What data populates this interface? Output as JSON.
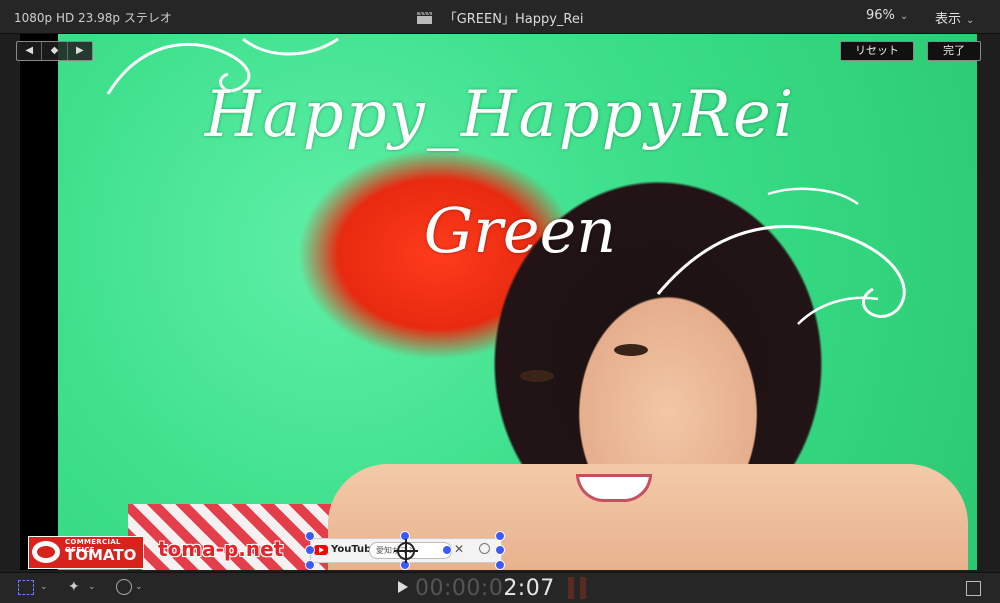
{
  "header": {
    "format_info": "1080p HD 23.98p ステレオ",
    "project_title": "「GREEN」Happy_Rei",
    "zoom_level": "96%",
    "view_menu": "表示",
    "chevron": "⌄"
  },
  "overlay_controls": {
    "prev_keyframe": "◀",
    "add_keyframe": "◆",
    "next_keyframe": "▶",
    "reset_label": "リセット",
    "done_label": "完了"
  },
  "video": {
    "title_line1": "Happy_HappyRei",
    "title_line2": "Green",
    "logo_small": "COMMERCIAL OFFICE",
    "logo_main": "TOMATO",
    "site_url": "toma-p.net",
    "youtube_word": "YouTube",
    "youtube_search_text": "愛知がマン",
    "youtube_close": "✕"
  },
  "playback": {
    "timecode_dim": "00:00:0",
    "timecode_bright": "2:07",
    "play_symbol": "▶"
  },
  "colors": {
    "accent_blue": "#3b5bff",
    "brand_red": "#d7231c",
    "chroma_green": "#3ee08c"
  }
}
